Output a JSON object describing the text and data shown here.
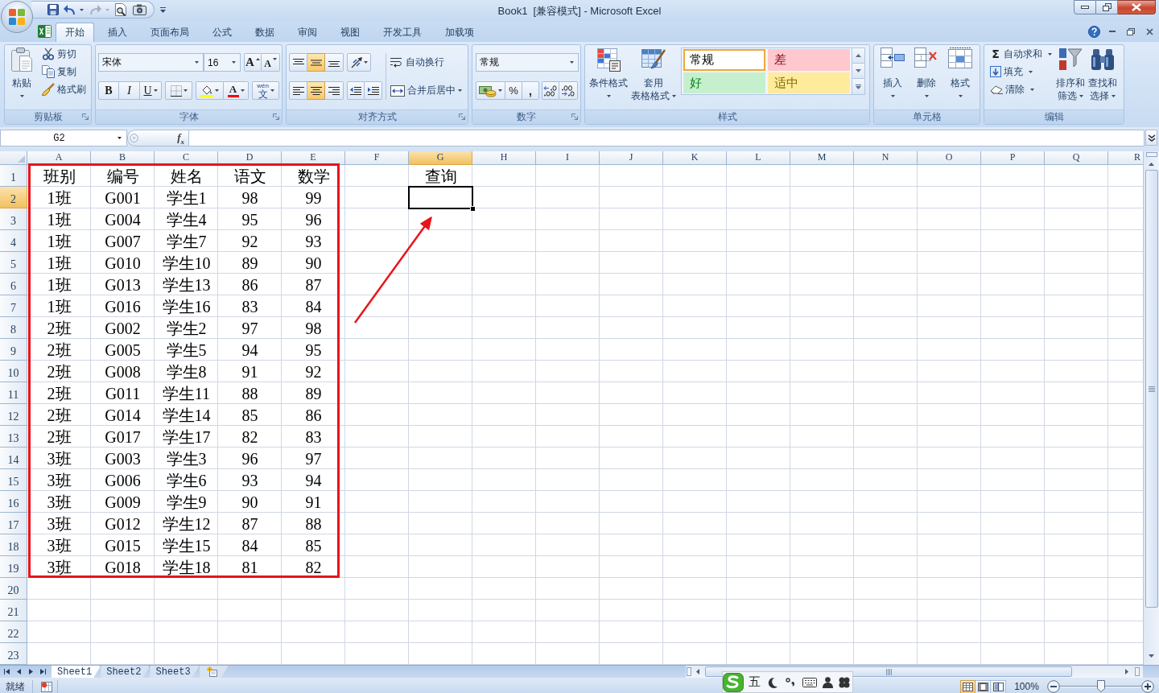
{
  "window": {
    "title": "Book1  [兼容模式] - Microsoft Excel"
  },
  "quick_access": [
    {
      "kind": "save",
      "disabled": false
    },
    {
      "kind": "undo",
      "disabled": false
    },
    {
      "kind": "redo",
      "disabled": true
    },
    {
      "kind": "print_preview",
      "disabled": false
    },
    {
      "kind": "camera",
      "disabled": false
    }
  ],
  "ribbon": {
    "tabs": [
      {
        "label": "开始",
        "selected": true
      },
      {
        "label": "插入",
        "selected": false
      },
      {
        "label": "页面布局",
        "selected": false
      },
      {
        "label": "公式",
        "selected": false
      },
      {
        "label": "数据",
        "selected": false
      },
      {
        "label": "审阅",
        "selected": false
      },
      {
        "label": "视图",
        "selected": false
      },
      {
        "label": "开发工具",
        "selected": false
      },
      {
        "label": "加载项",
        "selected": false
      }
    ],
    "groups": [
      {
        "kind": "clipboard",
        "title": "剪贴板",
        "paste": "粘贴",
        "cut": "剪切",
        "copy": "复制",
        "format_painter": "格式刷"
      },
      {
        "kind": "font",
        "title": "字体",
        "font_name": "宋体",
        "font_size": "16",
        "grow_font": "A",
        "shrink_font": "A",
        "bold": "B",
        "italic": "I",
        "underline": "U",
        "font_color": "A",
        "phonetic_pinyin": "wén",
        "phonetic": "文"
      },
      {
        "kind": "alignment",
        "title": "对齐方式",
        "vertical": [
          {
            "kind": "top",
            "selected": false
          },
          {
            "kind": "middle",
            "selected": true
          },
          {
            "kind": "bottom",
            "selected": false
          }
        ],
        "horizontal": [
          {
            "kind": "left",
            "selected": false
          },
          {
            "kind": "center",
            "selected": true
          },
          {
            "kind": "right",
            "selected": false
          }
        ],
        "wrap_text": "自动换行",
        "merge_center": "合并后居中"
      },
      {
        "kind": "number",
        "title": "数字",
        "format": "常规",
        "percent": "%",
        "comma": ","
      },
      {
        "kind": "styles",
        "title": "样式",
        "conditional_format": "条件格式",
        "format_as_table": [
          "套用",
          "表格格式"
        ],
        "gallery": [
          {
            "label": "常规",
            "color": "#ffffff",
            "selected": true
          },
          {
            "label": "差",
            "color": "#ffc7ce",
            "selected": false
          },
          {
            "label": "好",
            "color": "#c6efce",
            "selected": false
          },
          {
            "label": "适中",
            "color": "#ffeb9c",
            "selected": false
          }
        ]
      },
      {
        "kind": "cells",
        "title": "单元格",
        "buttons": [
          {
            "kind": "insert",
            "label": "插入"
          },
          {
            "kind": "delete",
            "label": "删除"
          },
          {
            "kind": "format",
            "label": "格式"
          }
        ]
      },
      {
        "kind": "editing",
        "title": "编辑",
        "small": [
          {
            "kind": "autosum",
            "symbol": "Σ",
            "label": "自动求和"
          },
          {
            "kind": "fill",
            "label": "填充"
          },
          {
            "kind": "clear",
            "label": "清除"
          }
        ],
        "large": [
          {
            "kind": "sort",
            "lines": [
              "排序和",
              "筛选"
            ]
          },
          {
            "kind": "find",
            "lines": [
              "查找和",
              "选择"
            ]
          }
        ]
      }
    ]
  },
  "formula_bar": {
    "name_box": "G2",
    "function_label": "f$_{x}$"
  },
  "sheet": {
    "columns": [
      {
        "label": "A",
        "selected": false
      },
      {
        "label": "B",
        "selected": false
      },
      {
        "label": "C",
        "selected": false
      },
      {
        "label": "D",
        "selected": false
      },
      {
        "label": "E",
        "selected": false
      },
      {
        "label": "F",
        "selected": false
      },
      {
        "label": "G",
        "selected": true
      },
      {
        "label": "H",
        "selected": false
      },
      {
        "label": "I",
        "selected": false
      },
      {
        "label": "J",
        "selected": false
      },
      {
        "label": "K",
        "selected": false
      },
      {
        "label": "L",
        "selected": false
      },
      {
        "label": "M",
        "selected": false
      },
      {
        "label": "N",
        "selected": false
      },
      {
        "label": "O",
        "selected": false
      },
      {
        "label": "P",
        "selected": false
      },
      {
        "label": "Q",
        "selected": false
      },
      {
        "label": "R",
        "selected": false
      }
    ],
    "rows": [
      {
        "label": "1",
        "selected": false,
        "cells": [
          "班别",
          "编号",
          "姓名",
          "语文",
          "数学",
          null,
          "查询"
        ]
      },
      {
        "label": "2",
        "selected": true,
        "cells": [
          "1班",
          "G001",
          "学生1",
          "98",
          "99"
        ]
      },
      {
        "label": "3",
        "selected": false,
        "cells": [
          "1班",
          "G004",
          "学生4",
          "95",
          "96"
        ]
      },
      {
        "label": "4",
        "selected": false,
        "cells": [
          "1班",
          "G007",
          "学生7",
          "92",
          "93"
        ]
      },
      {
        "label": "5",
        "selected": false,
        "cells": [
          "1班",
          "G010",
          "学生10",
          "89",
          "90"
        ]
      },
      {
        "label": "6",
        "selected": false,
        "cells": [
          "1班",
          "G013",
          "学生13",
          "86",
          "87"
        ]
      },
      {
        "label": "7",
        "selected": false,
        "cells": [
          "1班",
          "G016",
          "学生16",
          "83",
          "84"
        ]
      },
      {
        "label": "8",
        "selected": false,
        "cells": [
          "2班",
          "G002",
          "学生2",
          "97",
          "98"
        ]
      },
      {
        "label": "9",
        "selected": false,
        "cells": [
          "2班",
          "G005",
          "学生5",
          "94",
          "95"
        ]
      },
      {
        "label": "10",
        "selected": false,
        "cells": [
          "2班",
          "G008",
          "学生8",
          "91",
          "92"
        ]
      },
      {
        "label": "11",
        "selected": false,
        "cells": [
          "2班",
          "G011",
          "学生11",
          "88",
          "89"
        ]
      },
      {
        "label": "12",
        "selected": false,
        "cells": [
          "2班",
          "G014",
          "学生14",
          "85",
          "86"
        ]
      },
      {
        "label": "13",
        "selected": false,
        "cells": [
          "2班",
          "G017",
          "学生17",
          "82",
          "83"
        ]
      },
      {
        "label": "14",
        "selected": false,
        "cells": [
          "3班",
          "G003",
          "学生3",
          "96",
          "97"
        ]
      },
      {
        "label": "15",
        "selected": false,
        "cells": [
          "3班",
          "G006",
          "学生6",
          "93",
          "94"
        ]
      },
      {
        "label": "16",
        "selected": false,
        "cells": [
          "3班",
          "G009",
          "学生9",
          "90",
          "91"
        ]
      },
      {
        "label": "17",
        "selected": false,
        "cells": [
          "3班",
          "G012",
          "学生12",
          "87",
          "88"
        ]
      },
      {
        "label": "18",
        "selected": false,
        "cells": [
          "3班",
          "G015",
          "学生15",
          "84",
          "85"
        ]
      },
      {
        "label": "19",
        "selected": false,
        "cells": [
          "3班",
          "G018",
          "学生18",
          "81",
          "82"
        ]
      },
      {
        "label": "20",
        "selected": false
      },
      {
        "label": "21",
        "selected": false
      },
      {
        "label": "22",
        "selected": false
      },
      {
        "label": "23",
        "selected": false
      }
    ]
  },
  "sheet_tabs": [
    {
      "label": "Sheet1",
      "selected": true
    },
    {
      "label": "Sheet2",
      "selected": false
    },
    {
      "label": "Sheet3",
      "selected": false
    }
  ],
  "status_bar": {
    "ready": "就绪",
    "ime_mode": "五",
    "views": [
      {
        "kind": "normal",
        "selected": true
      },
      {
        "kind": "page_layout",
        "selected": false
      },
      {
        "kind": "page_break",
        "selected": false
      }
    ],
    "zoom": {
      "label": "100%",
      "level": 0.5
    }
  }
}
